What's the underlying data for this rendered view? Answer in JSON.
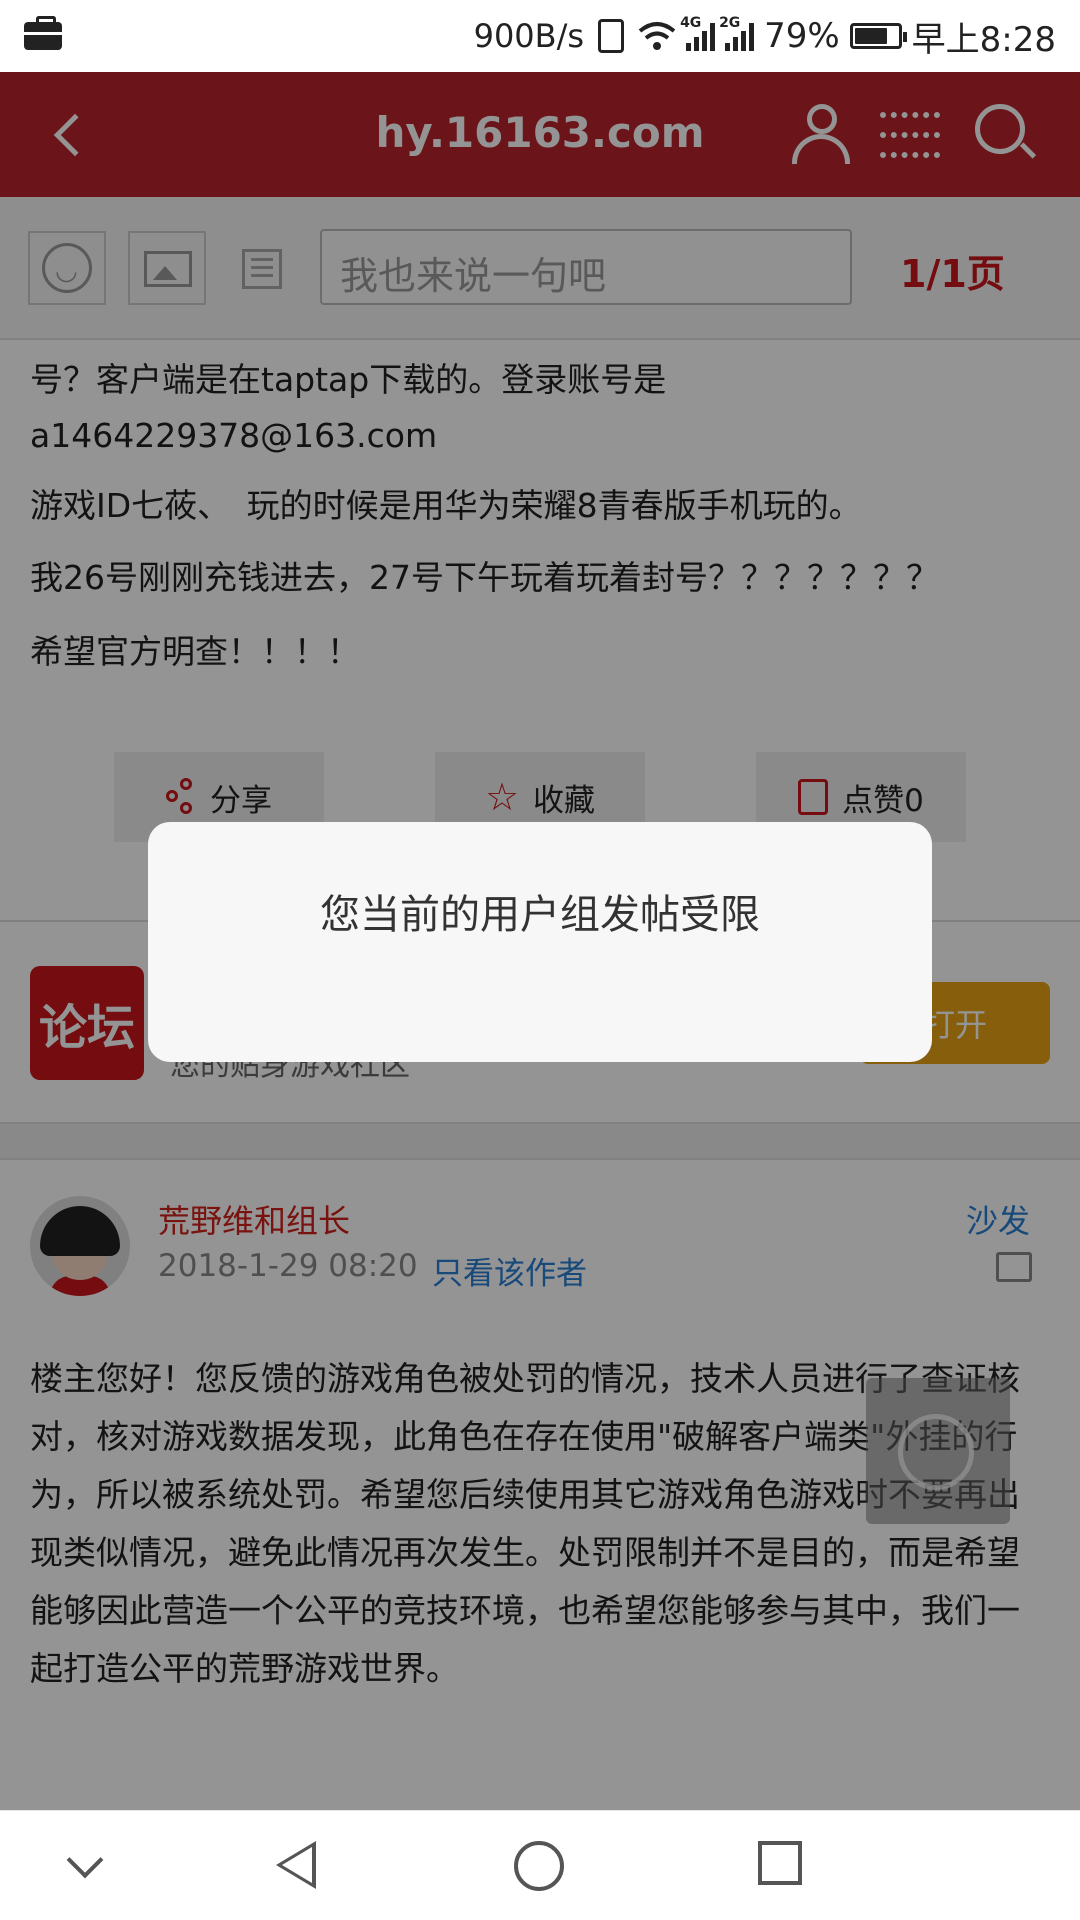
{
  "status_bar": {
    "net_speed": "900B/s",
    "sig1_label": "4G",
    "sig2_label": "2G",
    "battery_pct": "79%",
    "time": "早上8:28"
  },
  "nav": {
    "domain": "hy.16163.com"
  },
  "toolbar": {
    "input_placeholder": "我也来说一句吧",
    "page_indicator": "1/1页"
  },
  "post": {
    "lines": [
      "号？客户端是在taptap下载的。登录账号是",
      "a1464229378@163.com",
      "游戏ID七莜、　玩的时候是用华为荣耀8青春版手机玩的。",
      "我26号刚刚充钱进去，27号下午玩着玩着封号？？？？？？？",
      "希望官方明查！！！！"
    ],
    "share_label": "分享",
    "favorite_label": "收藏",
    "like_label": "点赞0"
  },
  "banner": {
    "logo_text": "论坛",
    "tagline": "您的贴身游戏社区",
    "open_label": "打开"
  },
  "reply": {
    "author": "荒野维和组长",
    "date": "2018-1-29 08:20",
    "only_author": "只看该作者",
    "floor": "沙发",
    "body": "楼主您好！您反馈的游戏角色被处罚的情况，技术人员进行了查证核对，核对游戏数据发现，此角色在存在使用\"破解客户端类\"外挂的行为，所以被系统处罚。希望您后续使用其它游戏角色游戏时不要再出现类似情况，避免此情况再次发生。处罚限制并不是目的，而是希望能够因此营造一个公平的竞技环境，也希望您能够参与其中，我们一起打造公平的荒野游戏世界。"
  },
  "dialog": {
    "message": "您当前的用户组发帖受限"
  },
  "colors": {
    "nav_bg": "#b9242c",
    "accent_red": "#c8161d",
    "link_blue": "#2a7fd4",
    "open_button": "#e8a415"
  }
}
